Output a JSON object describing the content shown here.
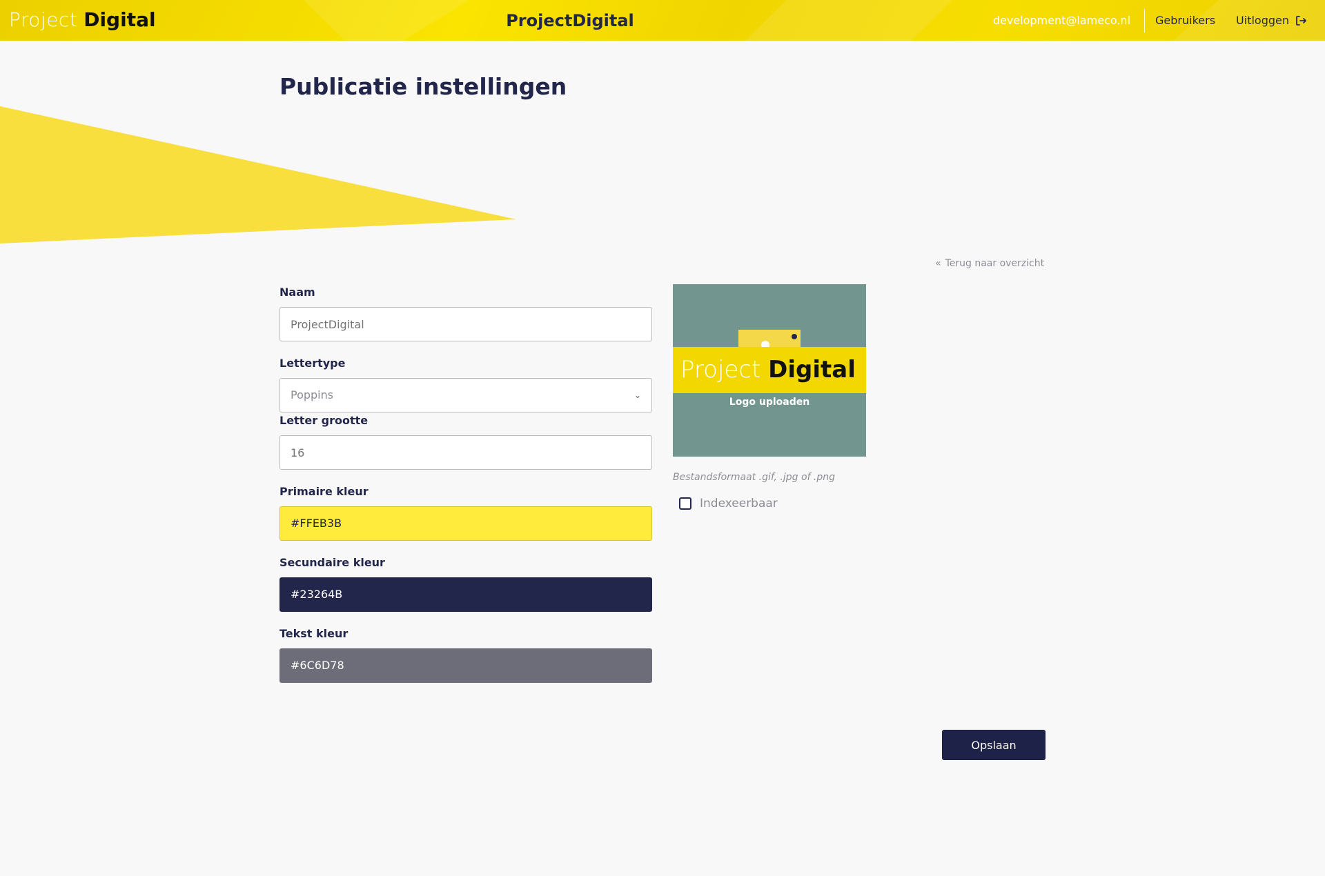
{
  "header": {
    "logo_light": "Project",
    "logo_bold": "Digital",
    "app_title": "ProjectDigital",
    "user_email": "development@lameco.nl",
    "users_link": "Gebruikers",
    "logout_link": "Uitloggen",
    "logout_icon": "logout-icon"
  },
  "page": {
    "title": "Publicatie instellingen",
    "back_link": "Terug naar overzicht",
    "back_icon": "double-chevron-left-icon"
  },
  "form": {
    "name": {
      "label": "Naam",
      "placeholder": "ProjectDigital"
    },
    "font": {
      "label": "Lettertype",
      "value": "Poppins"
    },
    "font_size": {
      "label": "Letter grootte",
      "placeholder": "16"
    },
    "primary_color": {
      "label": "Primaire kleur",
      "value": "#FFEB3B"
    },
    "secondary_color": {
      "label": "Secundaire kleur",
      "value": "#23264B"
    },
    "text_color": {
      "label": "Tekst kleur",
      "value": "#6C6D78"
    }
  },
  "upload": {
    "logo_light": "Project",
    "logo_bold": "Digital",
    "caption": "Logo uploaden",
    "file_hint": "Bestandsformaat .gif, .jpg of .png"
  },
  "indexable": {
    "label": "Indexeerbaar",
    "checked": false
  },
  "actions": {
    "save_label": "Opslaan"
  },
  "colors": {
    "brand_yellow": "#FFEB3B",
    "brand_navy": "#23264B",
    "text_gray": "#6C6D78",
    "upload_bg": "#72958F"
  }
}
